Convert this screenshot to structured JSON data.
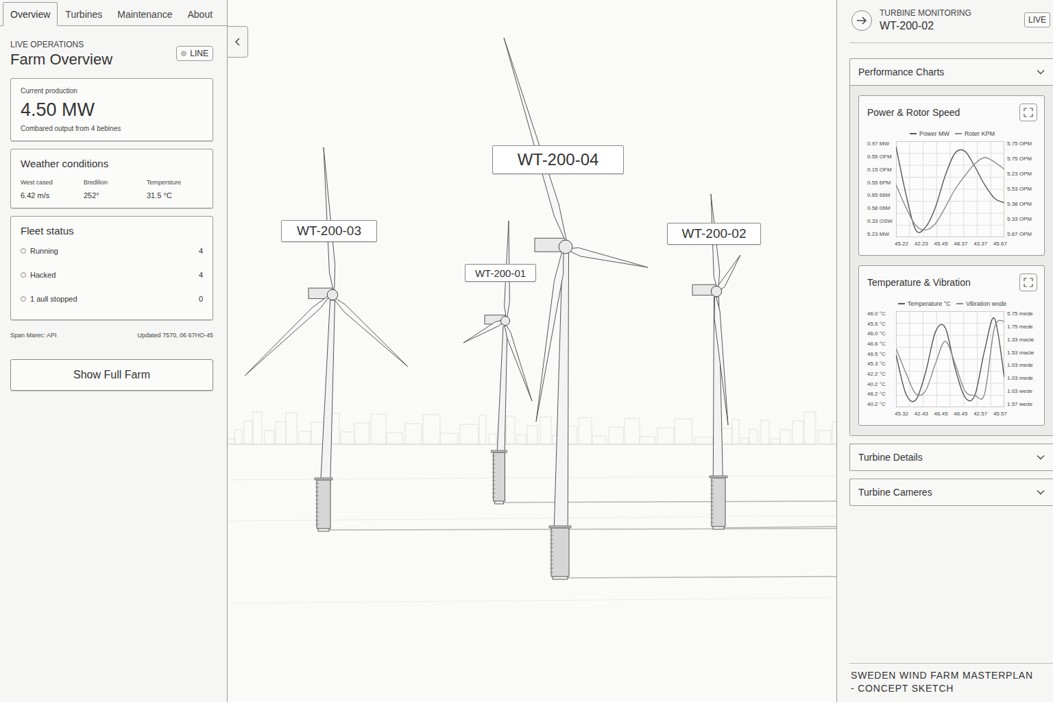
{
  "left_panel": {
    "tabs": [
      {
        "label": "Overview",
        "selected": true
      },
      {
        "label": "Turbines",
        "selected": false
      },
      {
        "label": "Maintenance",
        "selected": false
      },
      {
        "label": "About",
        "selected": false
      }
    ],
    "eyebrow": "LIVE OPERATIONS",
    "title": "Farm Overview",
    "badge": "LINE",
    "production": {
      "label": "Current production",
      "value": "4.50 MW",
      "caption": "Combared output from 4 bebines"
    },
    "weather": {
      "title": "Weather conditions",
      "items": [
        {
          "label": "West cased",
          "value": "6.42 m/s"
        },
        {
          "label": "Bredilion",
          "value": "252°"
        },
        {
          "label": "Tempersture",
          "value": "31.5 °C"
        }
      ]
    },
    "fleet": {
      "title": "Fleet status",
      "items": [
        {
          "label": "Running",
          "count": "4"
        },
        {
          "label": "Hacked",
          "count": "4"
        },
        {
          "label": "1 aull stopped",
          "count": "0"
        }
      ]
    },
    "source": "Span Marec: API",
    "updated": "Updated 7570, 06 67HO-45",
    "button": "Show Full Farm"
  },
  "turbines": [
    {
      "label": "WT-200-03"
    },
    {
      "label": "WT-200-04"
    },
    {
      "label": "WT-200-01"
    },
    {
      "label": "WT-200-02"
    }
  ],
  "right_panel": {
    "eyebrow": "TURBINE MONITORING",
    "title": "WT-200-02",
    "badge": "LIVE",
    "sections": [
      {
        "title": "Performance Charts",
        "expanded": true
      },
      {
        "title": "Turbine Details",
        "expanded": false
      },
      {
        "title": "Turbine Cameres",
        "expanded": false
      }
    ],
    "charts": [
      {
        "title": "Power & Rotor Speed",
        "series": [
          {
            "name": "Power MW",
            "color": "#555555",
            "values": [
              0.97,
              0.45,
              0.05,
              0.08,
              0.3,
              0.65,
              0.9,
              0.92,
              0.75,
              0.55,
              0.4,
              0.35
            ]
          },
          {
            "name": "Roter KPM",
            "color": "#8a8a8a",
            "values": [
              0.55,
              0.3,
              0.1,
              0.05,
              0.12,
              0.3,
              0.5,
              0.65,
              0.78,
              0.85,
              0.8,
              0.72
            ]
          }
        ],
        "y_left": [
          "0.97 MW",
          "0.55 OFM",
          "0.15 OFM",
          "0.55 6PM",
          "0.65 66M",
          "0.58 06M",
          "0.33 OSW",
          "5.23 MW"
        ],
        "y_right": [
          "5.75 OPM",
          "5.75 OPM",
          "5.23 OPM",
          "5.53 OPM",
          "5.38 OPM",
          "5.33 OPM",
          "5.67 OPM"
        ],
        "x": [
          "45.22",
          "42.23",
          "45.45",
          "48.37",
          "43.37",
          "45.67"
        ]
      },
      {
        "title": "Temperature & Vibration",
        "series": [
          {
            "name": "Temperature °C",
            "color": "#555555",
            "values": [
              0.55,
              0.12,
              0.05,
              0.35,
              0.8,
              0.85,
              0.4,
              0.08,
              0.1,
              0.6,
              0.95,
              0.3
            ]
          },
          {
            "name": "Vibration wode",
            "color": "#8a8a8a",
            "values": [
              0.62,
              0.35,
              0.12,
              0.15,
              0.45,
              0.7,
              0.45,
              0.15,
              0.1,
              0.12,
              0.85,
              0.92
            ]
          }
        ],
        "y_left": [
          "46.0 °C",
          "45.5 °C",
          "46.0 °C",
          "46.6 °C",
          "46.5 °C",
          "45.3 °C",
          "42.2 °C",
          "40.2 °C",
          "46.2 °C",
          "40.2 °C"
        ],
        "y_right": [
          "5.75 mede",
          "1.75 mede",
          "1.33 macle",
          "1.53 macle",
          "1.03 mede",
          "1.03 mede",
          "1.03 wede",
          "1.57 wede"
        ],
        "x": [
          "45.32",
          "42.43",
          "46.45",
          "46.45",
          "42.57",
          "45.57"
        ]
      }
    ],
    "footer": [
      "SWEDEN WIND FARM MASTERPLAN",
      "- CONCEPT SKETCH"
    ]
  }
}
